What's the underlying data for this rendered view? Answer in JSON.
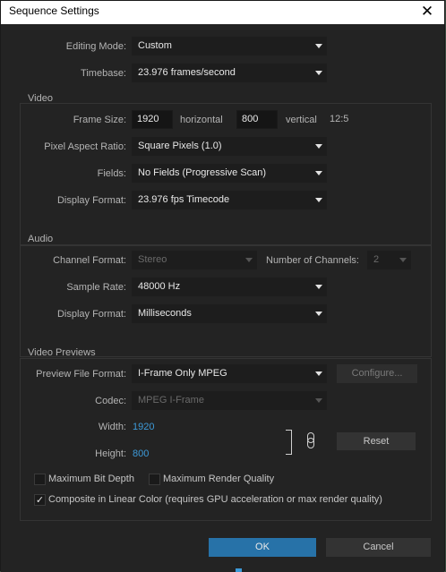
{
  "window": {
    "title": "Sequence Settings"
  },
  "general": {
    "editing_mode_label": "Editing Mode:",
    "editing_mode_value": "Custom",
    "timebase_label": "Timebase:",
    "timebase_value": "23.976 frames/second"
  },
  "video": {
    "group_title": "Video",
    "frame_size_label": "Frame Size:",
    "frame_width": "1920",
    "horizontal_label": "horizontal",
    "frame_height": "800",
    "vertical_label": "vertical",
    "aspect_ratio": "12:5",
    "pixel_aspect_label": "Pixel Aspect Ratio:",
    "pixel_aspect_value": "Square Pixels (1.0)",
    "fields_label": "Fields:",
    "fields_value": "No Fields (Progressive Scan)",
    "display_format_label": "Display Format:",
    "display_format_value": "23.976 fps Timecode"
  },
  "audio": {
    "group_title": "Audio",
    "channel_format_label": "Channel Format:",
    "channel_format_value": "Stereo",
    "num_channels_label": "Number of Channels:",
    "num_channels_value": "2",
    "sample_rate_label": "Sample Rate:",
    "sample_rate_value": "48000 Hz",
    "display_format_label": "Display Format:",
    "display_format_value": "Milliseconds"
  },
  "previews": {
    "group_title": "Video Previews",
    "file_format_label": "Preview File Format:",
    "file_format_value": "I-Frame Only MPEG",
    "configure_label": "Configure...",
    "codec_label": "Codec:",
    "codec_value": "MPEG I-Frame",
    "width_label": "Width:",
    "width_value": "1920",
    "height_label": "Height:",
    "height_value": "800",
    "reset_label": "Reset",
    "max_bit_depth_label": "Maximum Bit Depth",
    "max_bit_depth_checked": false,
    "max_render_quality_label": "Maximum Render Quality",
    "max_render_quality_checked": false,
    "linear_color_label": "Composite in Linear Color (requires GPU acceleration or max render quality)",
    "linear_color_checked": true,
    "check_glyph": "✓"
  },
  "footer": {
    "ok_label": "OK",
    "cancel_label": "Cancel"
  },
  "icons": {
    "close": "✕"
  },
  "colors": {
    "accent": "#2772a8",
    "value_blue": "#3d9ad8",
    "panel": "#232323"
  }
}
